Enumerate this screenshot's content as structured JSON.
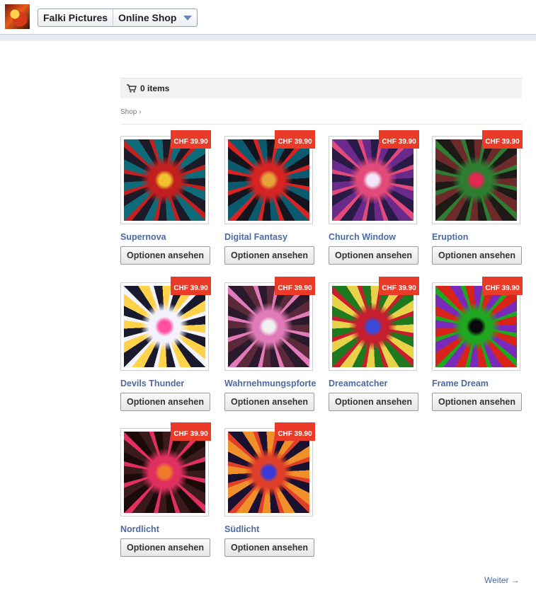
{
  "header": {
    "page_name": "Falki Pictures",
    "section": "Online Shop"
  },
  "cart": {
    "label": "0 items"
  },
  "breadcrumb": "Shop ›",
  "products": [
    {
      "name": "Supernova",
      "price": "CHF 39.90",
      "button": "Optionen ansehen"
    },
    {
      "name": "Digital Fantasy",
      "price": "CHF 39.90",
      "button": "Optionen ansehen"
    },
    {
      "name": "Church Window",
      "price": "CHF 39.90",
      "button": "Optionen ansehen"
    },
    {
      "name": "Eruption",
      "price": "CHF 39.90",
      "button": "Optionen ansehen"
    },
    {
      "name": "Devils Thunder",
      "price": "CHF 39.90",
      "button": "Optionen ansehen"
    },
    {
      "name": "Wahrnehmungspforte",
      "price": "CHF 39.90",
      "button": "Optionen ansehen"
    },
    {
      "name": "Dreamcatcher",
      "price": "CHF 39.90",
      "button": "Optionen ansehen"
    },
    {
      "name": "Frame Dream",
      "price": "CHF 39.90",
      "button": "Optionen ansehen"
    },
    {
      "name": "Nordlicht",
      "price": "CHF 39.90",
      "button": "Optionen ansehen"
    },
    {
      "name": "Südlicht",
      "price": "CHF 39.90",
      "button": "Optionen ansehen"
    }
  ],
  "pagination": {
    "next": "Weiter →"
  },
  "colors": {
    "price_badge": "#ea3a28",
    "link_blue": "#4d6aa3"
  }
}
